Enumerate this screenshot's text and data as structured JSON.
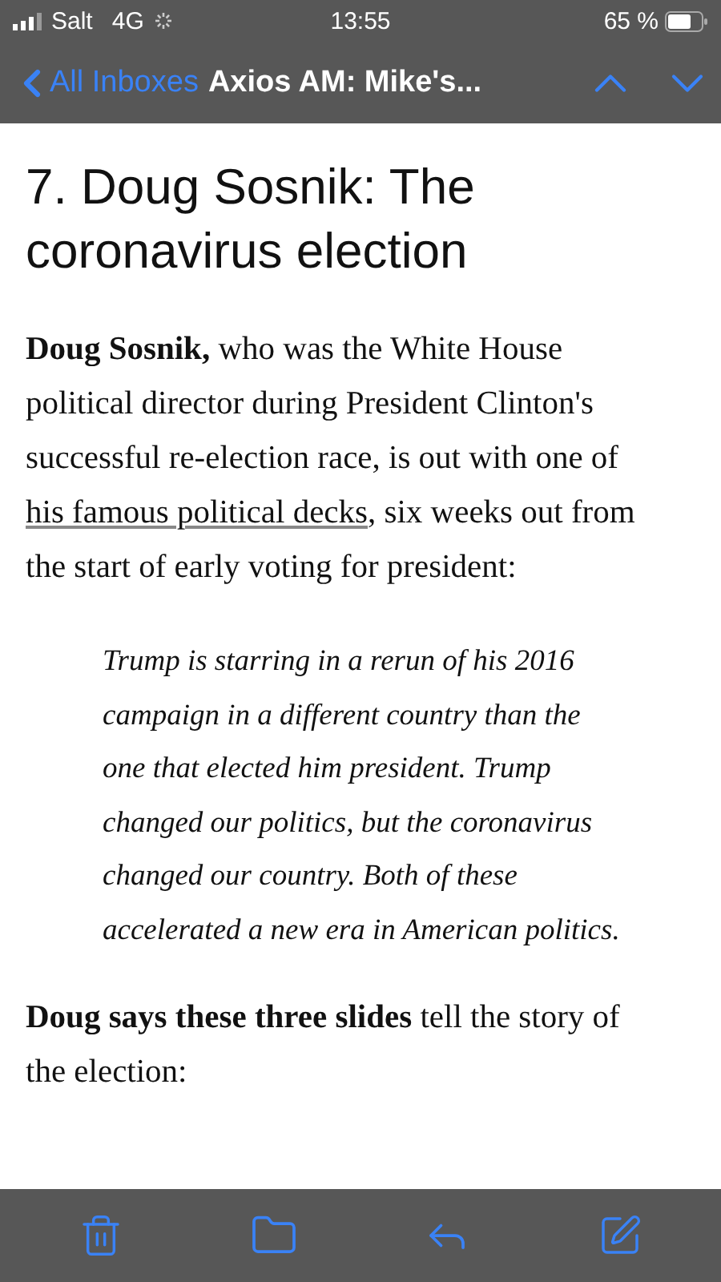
{
  "status_bar": {
    "carrier": "Salt",
    "network": "4G",
    "time": "13:55",
    "battery": "65 %"
  },
  "nav": {
    "back_label": "All Inboxes",
    "title": "Axios AM: Mike's..."
  },
  "article": {
    "heading": "7. Doug Sosnik: The coronavirus election",
    "blocks": [
      {
        "kind": "paragraph",
        "segments": [
          {
            "kind": "bold",
            "text": "Doug Sosnik,"
          },
          {
            "kind": "plain",
            "text": " who was the White House political director during President Clinton's successful re-election race, is out with one of "
          },
          {
            "kind": "link",
            "text": "his famous political decks"
          },
          {
            "kind": "plain",
            "text": ", six weeks out from the start of early voting for president:"
          }
        ]
      },
      {
        "kind": "quote",
        "segments": [
          {
            "kind": "plain",
            "text": "Trump is starring in a rerun of his 2016 campaign in a different country than the one that elected him president. Trump changed our politics, but the coronavirus changed our country. Both of these accelerated a new era in American politics."
          }
        ]
      },
      {
        "kind": "paragraph",
        "segments": [
          {
            "kind": "bold",
            "text": "Doug says these three slides"
          },
          {
            "kind": "plain",
            "text": " tell the story of the election:"
          }
        ]
      }
    ]
  }
}
